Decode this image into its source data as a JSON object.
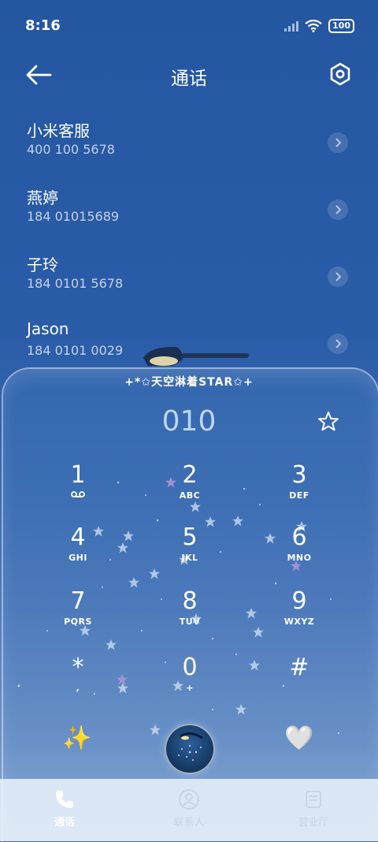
{
  "status": {
    "time": "8:16",
    "battery": "100"
  },
  "header": {
    "title": "通话",
    "back_icon": "arrow-left-icon",
    "settings_icon": "hexagon-settings-icon"
  },
  "contacts": [
    {
      "name": "小米客服",
      "number": "400 100 5678"
    },
    {
      "name": "燕婷",
      "number": "184 01015689"
    },
    {
      "name": "子玲",
      "number": "184 0101 5678"
    },
    {
      "name": "Jason",
      "number": "184 0101 0029"
    }
  ],
  "dialer": {
    "banner": "+*✩天空淋着STAR✩+",
    "entry": "010",
    "keys": [
      {
        "digit": "1",
        "letters": ""
      },
      {
        "digit": "2",
        "letters": "ABC"
      },
      {
        "digit": "3",
        "letters": "DEF"
      },
      {
        "digit": "4",
        "letters": "GHI"
      },
      {
        "digit": "5",
        "letters": "JKL"
      },
      {
        "digit": "6",
        "letters": "MNO"
      },
      {
        "digit": "7",
        "letters": "PQRS"
      },
      {
        "digit": "8",
        "letters": "TUV"
      },
      {
        "digit": "9",
        "letters": "WXYZ"
      },
      {
        "digit": "*",
        "letters": ","
      },
      {
        "digit": "0",
        "letters": "+"
      },
      {
        "digit": "#",
        "letters": ""
      }
    ],
    "left_action_icon": "✨",
    "right_action_icon": "🤍"
  },
  "tabs": [
    {
      "label": "通话",
      "icon": "phone-icon",
      "active": true
    },
    {
      "label": "联系人",
      "icon": "contacts-icon",
      "active": false
    },
    {
      "label": "营业厅",
      "icon": "store-icon",
      "active": false
    }
  ],
  "colors": {
    "bg_top": "#2456a2",
    "bg_bottom": "#8fb0d8",
    "accent": "#bcd6f5"
  }
}
